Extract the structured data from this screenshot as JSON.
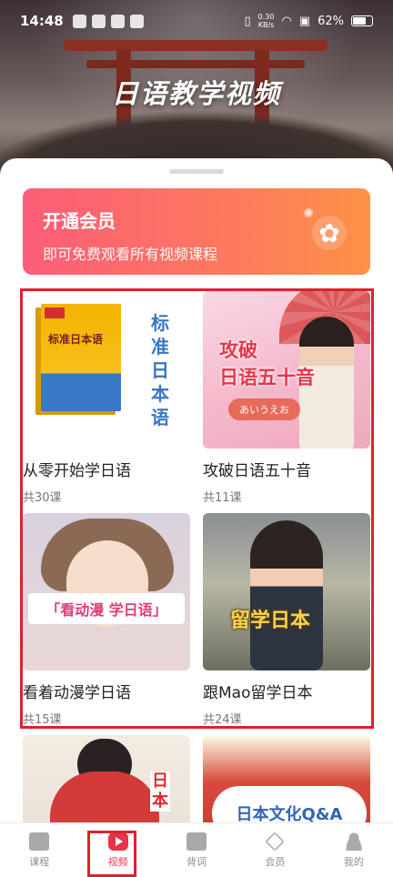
{
  "status_bar": {
    "time": "14:48",
    "net_speed_value": "0.30",
    "net_speed_unit": "KB/s",
    "battery": "62%"
  },
  "header": {
    "title": "日语教学视频"
  },
  "vip": {
    "title": "开通会员",
    "subtitle": "即可免费观看所有视频课程",
    "icon": "flower-icon"
  },
  "courses": [
    {
      "title": "从零开始学日语",
      "count": "共30课",
      "thumb_text": "标准日本语",
      "book_text": "标准日本语"
    },
    {
      "title": "攻破日语五十音",
      "count": "共11课",
      "thumb_text": "攻破\n日语五十音",
      "pill": "あいうえお"
    },
    {
      "title": "看着动漫学日语",
      "count": "共15课",
      "thumb_text": "「看动漫 学日语」"
    },
    {
      "title": "跟Mao留学日本",
      "count": "共24课",
      "thumb_text": "留学日本"
    },
    {
      "title": "",
      "count": "",
      "thumb_text": "日本"
    },
    {
      "title": "",
      "count": "",
      "thumb_text": "日本文化Q&A"
    }
  ],
  "tabs": [
    {
      "label": "课程",
      "icon": "book-icon"
    },
    {
      "label": "视频",
      "icon": "play-icon",
      "active": true
    },
    {
      "label": "背词",
      "icon": "word-cards-icon"
    },
    {
      "label": "会员",
      "icon": "diamond-icon"
    },
    {
      "label": "我的",
      "icon": "user-icon"
    }
  ],
  "colors": {
    "accent": "#e8334a",
    "vip_start": "#fb5d78",
    "vip_end": "#fd9246"
  }
}
